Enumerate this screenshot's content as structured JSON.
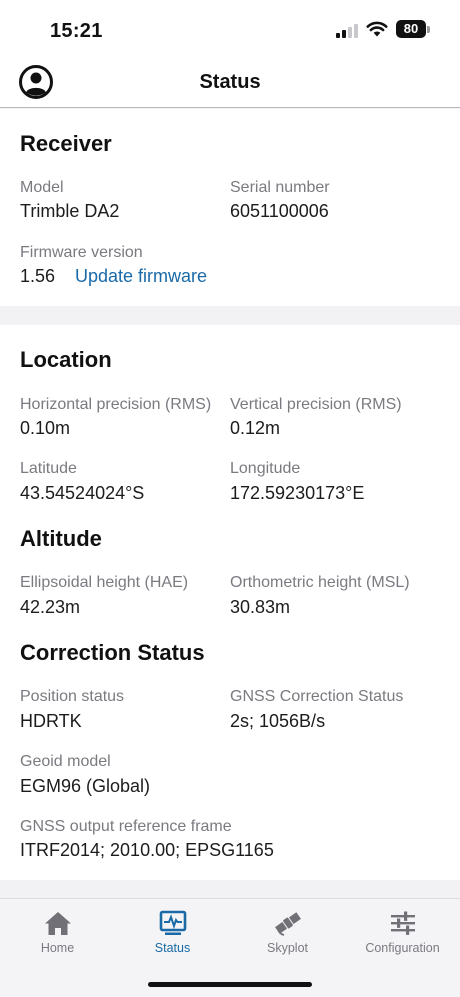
{
  "status_bar": {
    "time": "15:21",
    "battery": "80"
  },
  "nav": {
    "title": "Status",
    "avatar_icon": "account-circle-icon"
  },
  "receiver": {
    "title": "Receiver",
    "model_label": "Model",
    "model_value": "Trimble DA2",
    "serial_label": "Serial number",
    "serial_value": "6051100006",
    "firmware_label": "Firmware version",
    "firmware_value": "1.56",
    "update_link": "Update firmware"
  },
  "location": {
    "title": "Location",
    "hprec_label": "Horizontal precision (RMS)",
    "hprec_value": "0.10m",
    "vprec_label": "Vertical precision (RMS)",
    "vprec_value": "0.12m",
    "lat_label": "Latitude",
    "lat_value": "43.54524024°S",
    "lon_label": "Longitude",
    "lon_value": "172.59230173°E"
  },
  "altitude": {
    "title": "Altitude",
    "hae_label": "Ellipsoidal height (HAE)",
    "hae_value": "42.23m",
    "msl_label": "Orthometric height (MSL)",
    "msl_value": "30.83m"
  },
  "correction": {
    "title": "Correction Status",
    "pos_label": "Position status",
    "pos_value": "HDRTK",
    "gnss_label": "GNSS Correction Status",
    "gnss_value": "2s; 1056B/s",
    "geoid_label": "Geoid model",
    "geoid_value": "EGM96 (Global)",
    "frame_label": "GNSS output reference frame",
    "frame_value": "ITRF2014; 2010.00; EPSG1165"
  },
  "tabs": [
    {
      "label": "Home",
      "icon": "home-icon"
    },
    {
      "label": "Status",
      "icon": "status-monitor-icon"
    },
    {
      "label": "Skyplot",
      "icon": "satellite-icon"
    },
    {
      "label": "Configuration",
      "icon": "sliders-icon"
    }
  ],
  "colors": {
    "accent": "#1a6aa8",
    "label_gray": "#7a7a80",
    "background": "#f2f2f4"
  }
}
